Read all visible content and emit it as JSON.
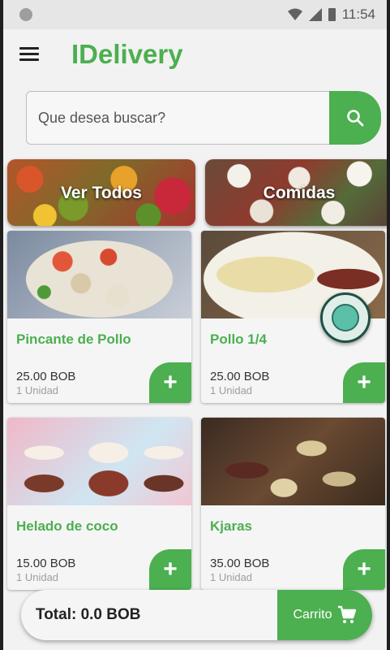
{
  "status_bar": {
    "time": "11:54"
  },
  "header": {
    "title": "IDelivery"
  },
  "search": {
    "placeholder": "Que desea buscar?"
  },
  "categories": [
    {
      "label": "Ver Todos"
    },
    {
      "label": "Comidas"
    }
  ],
  "products": [
    {
      "name": "Pincante de Pollo",
      "price": "25.00 BOB",
      "unit": "1 Unidad",
      "add_label": "+"
    },
    {
      "name": "Pollo 1/4",
      "price": "25.00 BOB",
      "unit": "1 Unidad",
      "add_label": "+"
    },
    {
      "name": "Helado de coco",
      "price": "15.00 BOB",
      "unit": "1 Unidad",
      "add_label": "+"
    },
    {
      "name": "Kjaras",
      "price": "35.00 BOB",
      "unit": "1 Unidad",
      "add_label": "+"
    }
  ],
  "cart": {
    "total": "Total: 0.0 BOB",
    "button_label": "Carrito"
  },
  "colors": {
    "accent": "#4caf50",
    "background": "#f2f2f2"
  },
  "icons": [
    "menu-icon",
    "search-icon",
    "cart-icon",
    "wifi-icon",
    "signal-icon",
    "battery-icon"
  ]
}
